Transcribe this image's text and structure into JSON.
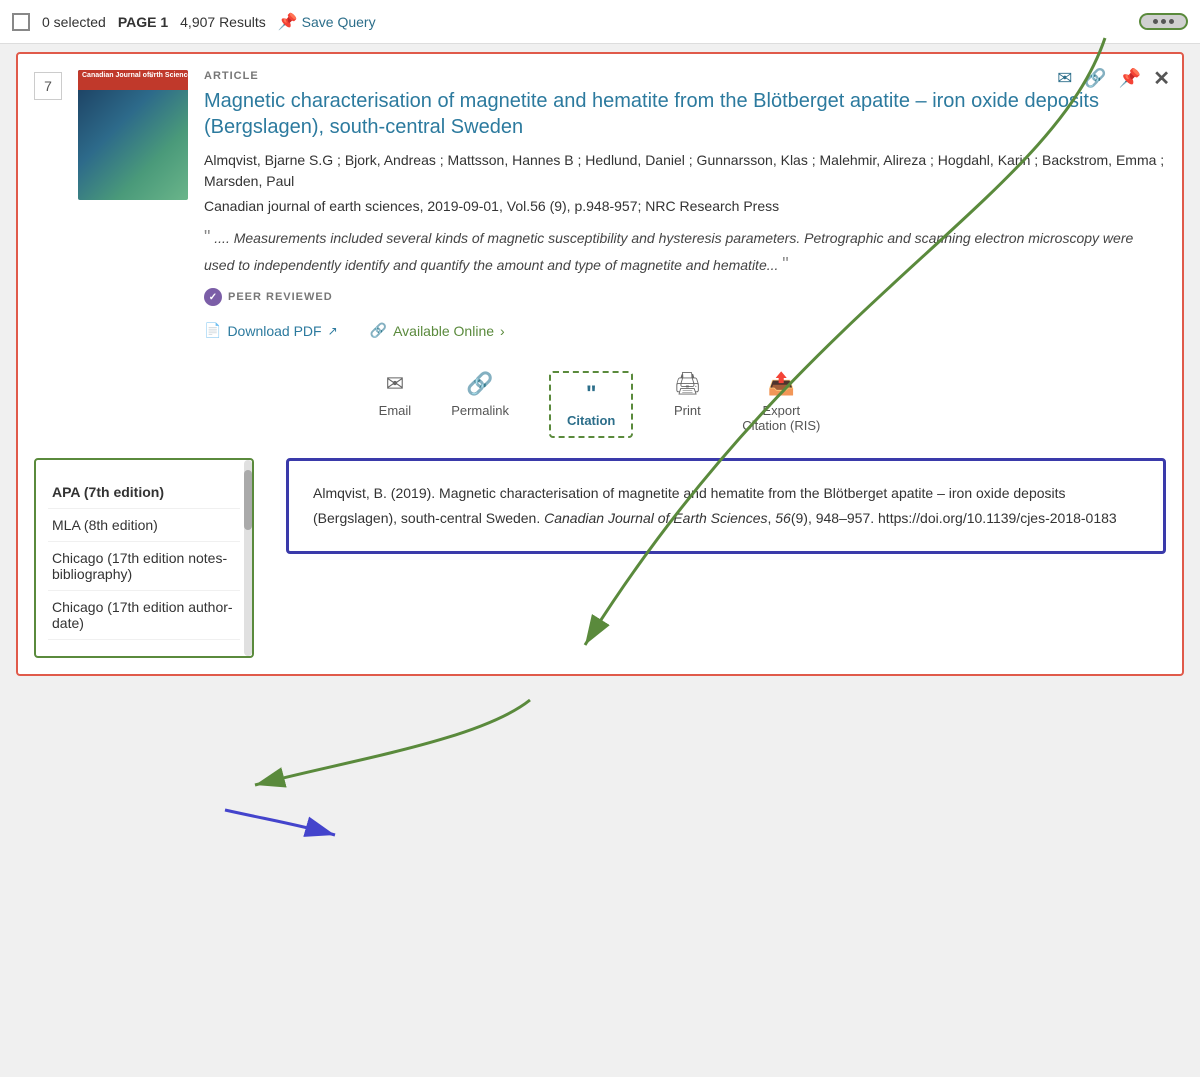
{
  "topbar": {
    "checkbox_label": "",
    "selected_text": "0 selected",
    "page_label": "PAGE 1",
    "results_text": "4,907 Results",
    "save_query_label": "Save Query",
    "more_options_aria": "More options"
  },
  "header_actions": {
    "email_aria": "Email",
    "link_aria": "Permalink",
    "pin_aria": "Pin",
    "close_aria": "Close"
  },
  "article": {
    "number": "7",
    "type": "ARTICLE",
    "title": "Magnetic characterisation of magnetite and hematite from the Blötberget apatite – iron oxide deposits (Bergslagen), south-central Sweden",
    "authors": "Almqvist, Bjarne S.G ; Bjork, Andreas ; Mattsson, Hannes B ; Hedlund, Daniel ; Gunnarsson, Klas ; Malehmir, Alireza ; Hogdahl, Karin ; Backstrom, Emma ; Marsden, Paul",
    "journal": "Canadian journal of earth sciences, 2019-09-01, Vol.56 (9), p.948-957; NRC Research Press",
    "abstract": ".... Measurements included several kinds of magnetic susceptibility and hysteresis parameters. Petrographic and scanning electron microscopy were used to independently identify and quantify the amount and type of magnetite and hematite...",
    "peer_reviewed": "PEER REVIEWED",
    "download_pdf": "Download PDF",
    "available_online": "Available Online"
  },
  "actions": {
    "email_label": "Email",
    "permalink_label": "Permalink",
    "citation_label": "Citation",
    "print_label": "Print",
    "export_label": "Export Citation (RIS)"
  },
  "citation": {
    "formats": [
      {
        "id": "apa",
        "label": "APA (7th edition)",
        "active": true
      },
      {
        "id": "mla",
        "label": "MLA (8th edition)",
        "active": false
      },
      {
        "id": "chicago17notes",
        "label": "Chicago (17th edition notes-bibliography)",
        "active": false
      },
      {
        "id": "chicago17author",
        "label": "Chicago (17th edition author-date)",
        "active": false
      }
    ],
    "apa_text": "Almqvist, B. (2019). Magnetic characterisation of magnetite and hematite from the Blötberget apatite – iron oxide deposits (Bergslagen), south-central Sweden. Canadian Journal of Earth Sciences, 56(9), 948–957. https://doi.org/10.1139/cjes-2018-0183"
  }
}
